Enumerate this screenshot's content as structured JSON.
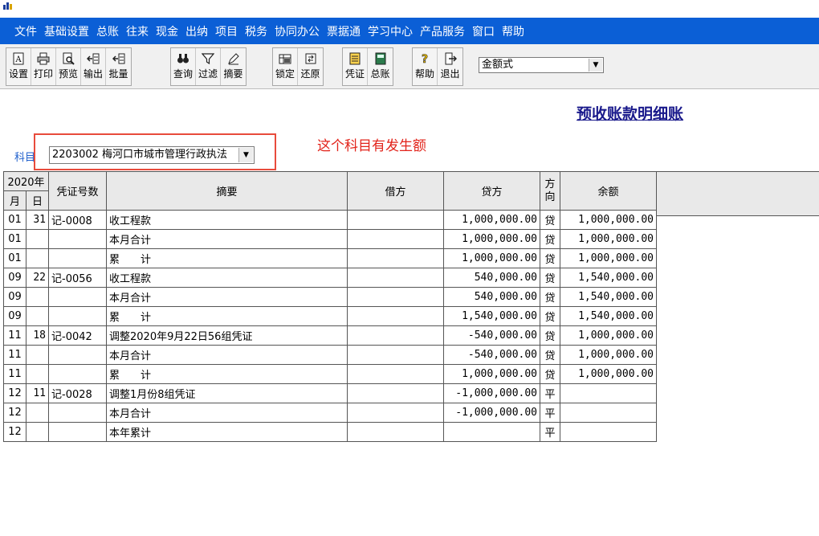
{
  "menubar": {
    "items": [
      "文件",
      "基础设置",
      "总账",
      "往来",
      "现金",
      "出纳",
      "项目",
      "税务",
      "协同办公",
      "票据通",
      "学习中心",
      "产品服务",
      "窗口",
      "帮助"
    ]
  },
  "toolbar": {
    "settings": "设置",
    "print": "打印",
    "preview": "预览",
    "export": "输出",
    "batch": "批量",
    "query": "查询",
    "filter": "过滤",
    "summary": "摘要",
    "lock": "锁定",
    "restore": "还原",
    "voucher": "凭证",
    "ledger": "总账",
    "help": "帮助",
    "exit": "退出",
    "format_value": "金额式"
  },
  "report": {
    "title": "预收账款明细账",
    "annotation": "这个科目有发生额",
    "subject_label": "科目",
    "subject_value": "2203002 梅河口市城市管理行政执法"
  },
  "table": {
    "headers": {
      "year": "2020年",
      "month": "月",
      "day": "日",
      "voucher_no": "凭证号数",
      "summary": "摘要",
      "debit": "借方",
      "credit": "贷方",
      "direction": "方向",
      "balance": "余额"
    },
    "rows": [
      {
        "month": "01",
        "day": "31",
        "voucher": "记-0008",
        "summary": "收工程款",
        "debit": "",
        "credit": "1,000,000.00",
        "dir": "贷",
        "balance": "1,000,000.00"
      },
      {
        "month": "01",
        "day": "",
        "voucher": "",
        "summary": "本月合计",
        "debit": "",
        "credit": "1,000,000.00",
        "dir": "贷",
        "balance": "1,000,000.00"
      },
      {
        "month": "01",
        "day": "",
        "voucher": "",
        "summary": "累　　计",
        "debit": "",
        "credit": "1,000,000.00",
        "dir": "贷",
        "balance": "1,000,000.00"
      },
      {
        "month": "09",
        "day": "22",
        "voucher": "记-0056",
        "summary": "收工程款",
        "debit": "",
        "credit": "540,000.00",
        "dir": "贷",
        "balance": "1,540,000.00"
      },
      {
        "month": "09",
        "day": "",
        "voucher": "",
        "summary": "本月合计",
        "debit": "",
        "credit": "540,000.00",
        "dir": "贷",
        "balance": "1,540,000.00"
      },
      {
        "month": "09",
        "day": "",
        "voucher": "",
        "summary": "累　　计",
        "debit": "",
        "credit": "1,540,000.00",
        "dir": "贷",
        "balance": "1,540,000.00"
      },
      {
        "month": "11",
        "day": "18",
        "voucher": "记-0042",
        "summary": "调整2020年9月22日56组凭证",
        "debit": "",
        "credit": "-540,000.00",
        "dir": "贷",
        "balance": "1,000,000.00"
      },
      {
        "month": "11",
        "day": "",
        "voucher": "",
        "summary": "本月合计",
        "debit": "",
        "credit": "-540,000.00",
        "dir": "贷",
        "balance": "1,000,000.00"
      },
      {
        "month": "11",
        "day": "",
        "voucher": "",
        "summary": "累　　计",
        "debit": "",
        "credit": "1,000,000.00",
        "dir": "贷",
        "balance": "1,000,000.00"
      },
      {
        "month": "12",
        "day": "11",
        "voucher": "记-0028",
        "summary": "调整1月份8组凭证",
        "debit": "",
        "credit": "-1,000,000.00",
        "dir": "平",
        "balance": ""
      },
      {
        "month": "12",
        "day": "",
        "voucher": "",
        "summary": "本月合计",
        "debit": "",
        "credit": "-1,000,000.00",
        "dir": "平",
        "balance": ""
      },
      {
        "month": "12",
        "day": "",
        "voucher": "",
        "summary": "本年累计",
        "debit": "",
        "credit": "",
        "dir": "平",
        "balance": ""
      }
    ]
  }
}
